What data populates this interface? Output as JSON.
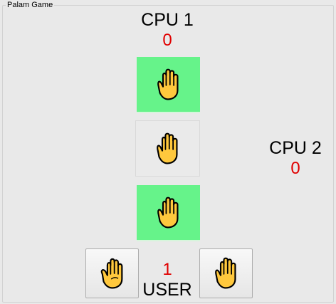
{
  "window": {
    "title": "Palam Game"
  },
  "cpu1": {
    "label": "CPU 1",
    "score": "0"
  },
  "cpu2": {
    "label": "CPU 2",
    "score": "0"
  },
  "user": {
    "label": "USER",
    "score": "1"
  },
  "icons": {
    "cpu1_hand": "raised-hand-palm-icon",
    "center_hand": "raised-hand-palm-icon",
    "cpu2_hand": "raised-hand-palm-icon",
    "user_left": "raised-hand-back-icon",
    "user_right": "raised-hand-palm-icon"
  },
  "colors": {
    "score": "#e00000",
    "highlight": "#66f38a",
    "hand_fill": "#ffc83d",
    "hand_outline": "#000000"
  }
}
